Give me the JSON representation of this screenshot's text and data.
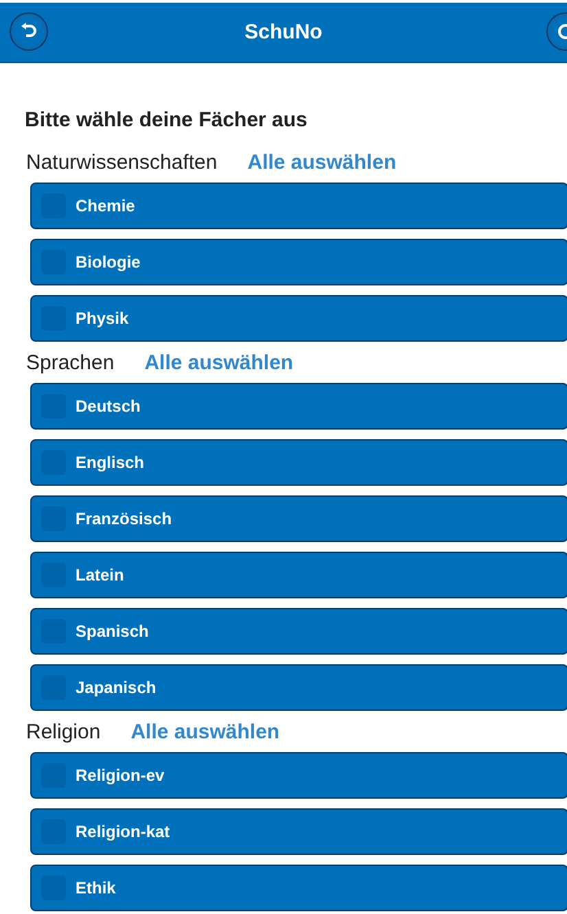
{
  "header": {
    "title": "SchuNo"
  },
  "heading": "Bitte wähle deine Fächer aus",
  "groups": [
    {
      "label": "Naturwissenschaften",
      "select_all": "Alle auswählen",
      "items": [
        {
          "label": "Chemie",
          "checked": false
        },
        {
          "label": "Biologie",
          "checked": false
        },
        {
          "label": "Physik",
          "checked": false
        }
      ]
    },
    {
      "label": "Sprachen",
      "select_all": "Alle auswählen",
      "items": [
        {
          "label": "Deutsch",
          "checked": false
        },
        {
          "label": "Englisch",
          "checked": false
        },
        {
          "label": "Französisch",
          "checked": false
        },
        {
          "label": "Latein",
          "checked": false
        },
        {
          "label": "Spanisch",
          "checked": false
        },
        {
          "label": "Japanisch",
          "checked": false
        }
      ]
    },
    {
      "label": "Religion",
      "select_all": "Alle auswählen",
      "items": [
        {
          "label": "Religion-ev",
          "checked": false
        },
        {
          "label": "Religion-kat",
          "checked": false
        },
        {
          "label": "Ethik",
          "checked": false
        }
      ]
    }
  ]
}
